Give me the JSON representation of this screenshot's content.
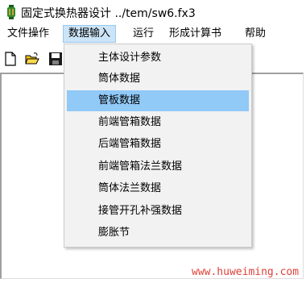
{
  "window": {
    "title": "固定式换热器设计 ../tem/sw6.fx3"
  },
  "menubar": {
    "items": [
      {
        "label": "文件操作",
        "active": false
      },
      {
        "label": "数据输入",
        "active": true
      },
      {
        "label": "运行",
        "active": false
      },
      {
        "label": "形成计算书",
        "active": false
      },
      {
        "label": "帮助",
        "active": false
      }
    ]
  },
  "toolbar": {
    "buttons": [
      {
        "icon": "new-document-icon"
      },
      {
        "icon": "open-folder-icon"
      },
      {
        "icon": "save-disk-icon"
      }
    ]
  },
  "dropdown": {
    "items": [
      {
        "label": "主体设计参数",
        "selected": false
      },
      {
        "label": "筒体数据",
        "selected": false
      },
      {
        "label": "管板数据",
        "selected": true
      },
      {
        "label": "前端管箱数据",
        "selected": false
      },
      {
        "label": "后端管箱数据",
        "selected": false
      },
      {
        "label": "前端管箱法兰数据",
        "selected": false
      },
      {
        "label": "筒体法兰数据",
        "selected": false
      },
      {
        "label": "接管开孔补强数据",
        "selected": false
      },
      {
        "label": "膨胀节",
        "selected": false
      }
    ]
  },
  "watermark": {
    "text": "www.huweiming.com"
  },
  "colors": {
    "selected_item": "#91c9f7",
    "active_menu": "#cce4f7",
    "watermark": "#e0413a"
  }
}
